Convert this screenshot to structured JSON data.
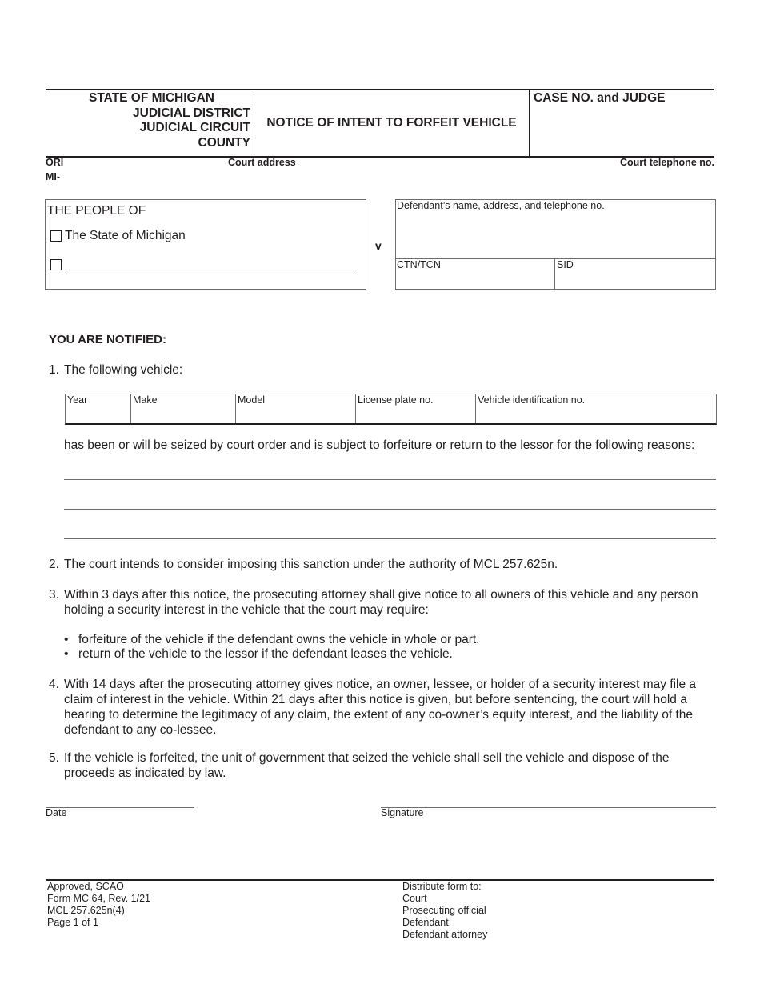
{
  "header": {
    "court_lines": [
      "STATE OF MICHIGAN",
      "JUDICIAL DISTRICT",
      "JUDICIAL CIRCUIT",
      "COUNTY"
    ],
    "title": "NOTICE OF INTENT TO FORFEIT VEHICLE",
    "case_label": "CASE NO. and JUDGE"
  },
  "subheader": {
    "ori_label": "ORI",
    "mi_prefix": "MI-",
    "court_address_label": "Court address",
    "court_telephone_label": "Court telephone no."
  },
  "parties": {
    "plaintiff_title": "THE PEOPLE OF",
    "state_option": "The State of Michigan",
    "state_checked": false,
    "other_checked": false,
    "other_value": "",
    "versus": "v",
    "defendant_label": "Defendant’s name, address, and telephone no.",
    "ctn_label": "CTN/TCN",
    "sid_label": "SID"
  },
  "body": {
    "notified_heading": "YOU ARE NOTIFIED:",
    "item1": {
      "num": "1.",
      "text": "The following vehicle:"
    },
    "vehicle_columns": [
      "Year",
      "Make",
      "Model",
      "License plate no.",
      "Vehicle identification no."
    ],
    "seized_text": "has been or will be seized by court order and is subject to forfeiture or return to the lessor for the following reasons:",
    "reasons": [
      "",
      "",
      ""
    ],
    "item2": {
      "num": "2.",
      "text": "The court intends to consider imposing this sanction under the authority of MCL 257.625n."
    },
    "item3": {
      "num": "3.",
      "text": "Within 3 days after this notice, the prosecuting attorney shall give notice to all owners of this vehicle and any person holding a security interest in the vehicle that the court may require:"
    },
    "item3_bullets": [
      "forfeiture of the vehicle if the defendant owns the vehicle in whole or part.",
      "return of the vehicle to the lessor if the defendant leases the vehicle."
    ],
    "item4": {
      "num": "4.",
      "text": "With 14 days after the prosecuting attorney gives notice, an owner, lessee, or holder of a security interest may file a claim of interest in the vehicle. Within 21 days after this notice is given, but before sentencing, the court will hold a hearing to determine the legitimacy of any claim, the extent of any co-owner’s equity interest, and the liability of the defendant to any co-lessee."
    },
    "item5": {
      "num": "5.",
      "text": "If the vehicle is forfeited, the unit of government that seized the vehicle shall sell the vehicle and dispose of the proceeds as indicated by law."
    }
  },
  "signature": {
    "date_label": "Date",
    "signature_label": "Signature"
  },
  "footer": {
    "left": [
      "Approved, SCAO",
      "Form MC 64, Rev. 1/21",
      "MCL 257.625n(4)",
      "Page 1 of 1"
    ],
    "right": [
      "Distribute form to:",
      "Court",
      "Prosecuting official",
      "Defendant",
      "Defendant attorney"
    ]
  }
}
